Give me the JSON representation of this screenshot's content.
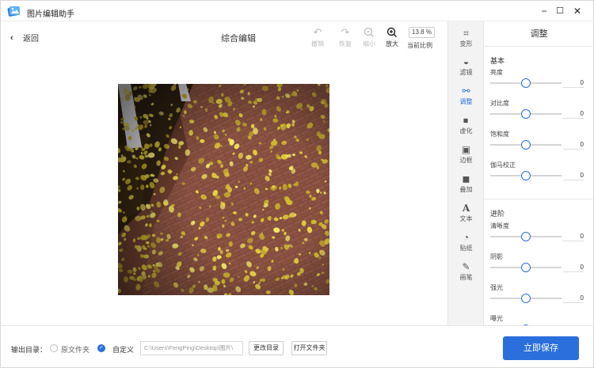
{
  "app": {
    "title": "图片编辑助手"
  },
  "window_controls": {
    "minimize": "−",
    "restore": "☐",
    "close": "✕"
  },
  "toolbar": {
    "back_label": "返回",
    "page_title": "综合编辑",
    "undo_label": "撤销",
    "redo_label": "恢复",
    "zoom_out_label": "缩小",
    "zoom_in_label": "放大",
    "zoom_value": "13.8 %",
    "current_ratio_label": "当前比例"
  },
  "side_tools": [
    {
      "label": "变形",
      "icon": "crop-icon"
    },
    {
      "label": "滤镜",
      "icon": "filter-icon"
    },
    {
      "label": "调整",
      "icon": "adjust-icon"
    },
    {
      "label": "虚化",
      "icon": "blur-icon"
    },
    {
      "label": "边框",
      "icon": "frame-icon"
    },
    {
      "label": "叠加",
      "icon": "overlay-icon"
    },
    {
      "label": "文本",
      "icon": "text-icon"
    },
    {
      "label": "贴纸",
      "icon": "sticker-icon"
    },
    {
      "label": "画笔",
      "icon": "brush-icon"
    }
  ],
  "panel": {
    "title": "调整",
    "basic_title": "基本",
    "advanced_title": "进阶",
    "basic": [
      {
        "label": "亮度",
        "value": "0",
        "level": 0.5
      },
      {
        "label": "对比度",
        "value": "0",
        "level": 0.5
      },
      {
        "label": "饱和度",
        "value": "0",
        "level": 0.5
      },
      {
        "label": "伽马校正",
        "value": "0",
        "level": 0.5
      }
    ],
    "advanced": [
      {
        "label": "清晰度",
        "value": "0",
        "level": 0.5
      },
      {
        "label": "阴影",
        "value": "0",
        "level": 0.5
      },
      {
        "label": "强光",
        "value": "0",
        "level": 0.5
      },
      {
        "label": "曝光",
        "value": "",
        "level": 0.5
      }
    ]
  },
  "footer": {
    "output_label": "输出目录：",
    "original_folder_label": "原文件夹",
    "custom_label": "自定义",
    "path_value": "C:\\Users\\FengPing\\Desktop\\图片\\",
    "change_dir_label": "更改目录",
    "open_folder_label": "打开文件夹",
    "save_label": "立即保存"
  },
  "colors": {
    "accent": "#2a6fdc"
  }
}
